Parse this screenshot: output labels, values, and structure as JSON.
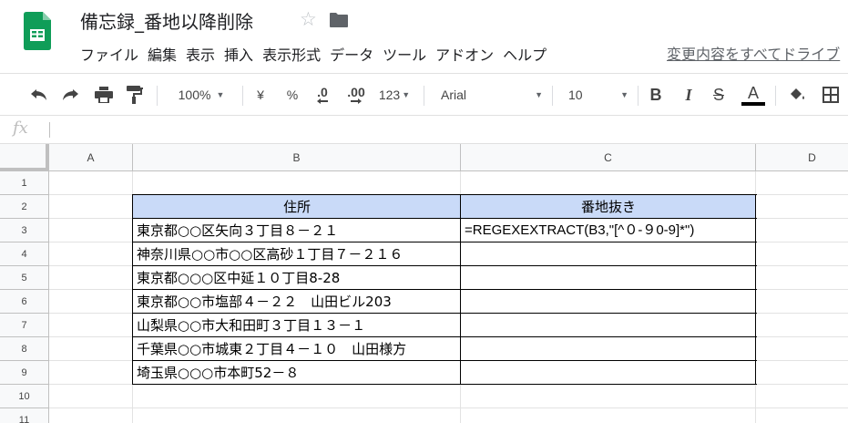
{
  "app": {
    "doc_title": "備忘録_番地以降削除",
    "menu": [
      "ファイル",
      "編集",
      "表示",
      "挿入",
      "表示形式",
      "データ",
      "ツール",
      "アドオン",
      "ヘルプ"
    ],
    "last_edit": "変更内容をすべてドライブ"
  },
  "toolbar": {
    "zoom": "100%",
    "currency": "¥",
    "percent": "%",
    "dec_decrease": ".0",
    "dec_increase": ".00",
    "number_format": "123",
    "font": "Arial",
    "font_size": "10",
    "bold": "B",
    "italic": "I",
    "strike": "S",
    "text_color": "A"
  },
  "formula_bar": {
    "fx": "fx",
    "value": ""
  },
  "sheet": {
    "columns": [
      "A",
      "B",
      "C",
      "D"
    ],
    "rows": [
      "1",
      "2",
      "3",
      "4",
      "5",
      "6",
      "7",
      "8",
      "9",
      "10",
      "11"
    ],
    "table": {
      "headers": [
        "住所",
        "番地抜き"
      ],
      "rows": [
        [
          "東京都○○区矢向３丁目８－２１",
          "=REGEXEXTRACT(B3,\"[^０-９0-9]*\")"
        ],
        [
          "神奈川県○○市○○区高砂１丁目７－２１６",
          ""
        ],
        [
          "東京都○○○区中延１０丁目8-28",
          ""
        ],
        [
          "東京都○○市塩部４－２２　山田ビル203",
          ""
        ],
        [
          "山梨県○○市大和田町３丁目１３－１",
          ""
        ],
        [
          "千葉県○○市城東２丁目４－１０　山田様方",
          ""
        ],
        [
          "埼玉県○○○市本町52－８",
          ""
        ]
      ]
    },
    "header_fill": "#c9daf8"
  },
  "colors": {
    "sheets_green": "#0f9d58",
    "grid_line": "#e2e2e2"
  }
}
